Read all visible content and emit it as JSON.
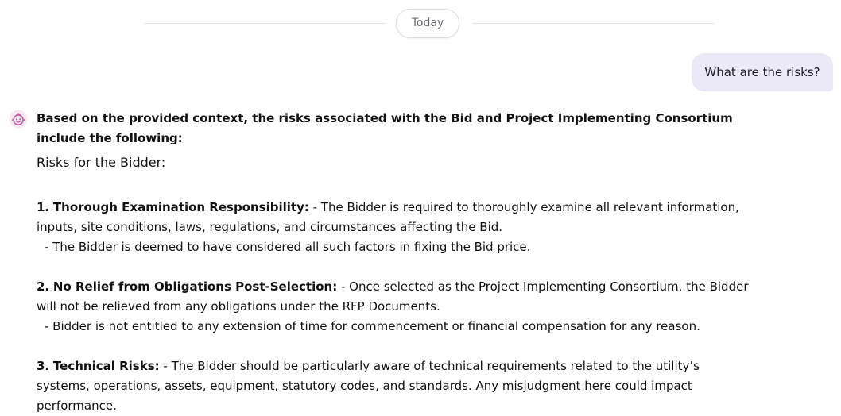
{
  "divider": {
    "label": "Today"
  },
  "user_message": {
    "text": "What are the risks?"
  },
  "bot_avatar": {
    "icon": "bot-face-icon",
    "accent": "#c0509b"
  },
  "answer": {
    "intro": "Based on the provided context, the risks associated with the Bid and Project Implementing Consortium include the following:",
    "section_title": "Risks for the Bidder:",
    "risks": [
      {
        "number": "1.",
        "title": "Thorough Examination Responsibility:",
        "text": " - The Bidder is required to thoroughly examine all relevant information, inputs, site conditions, laws, regulations, and circumstances affecting the Bid.",
        "sub": "- The Bidder is deemed to have considered all such factors in fixing the Bid price."
      },
      {
        "number": "2.",
        "title": "No Relief from Obligations Post-Selection:",
        "text": " - Once selected as the Project Implementing Consortium, the Bidder will not be relieved from any obligations under the RFP Documents.",
        "sub": "- Bidder is not entitled to any extension of time for commencement or financial compensation for any reason."
      },
      {
        "number": "3.",
        "title": "Technical Risks:",
        "text": " - The Bidder should be particularly aware of technical requirements related to the utility’s systems, operations, assets, equipment, statutory codes, and standards. Any misjudgment here could impact performance."
      }
    ]
  }
}
